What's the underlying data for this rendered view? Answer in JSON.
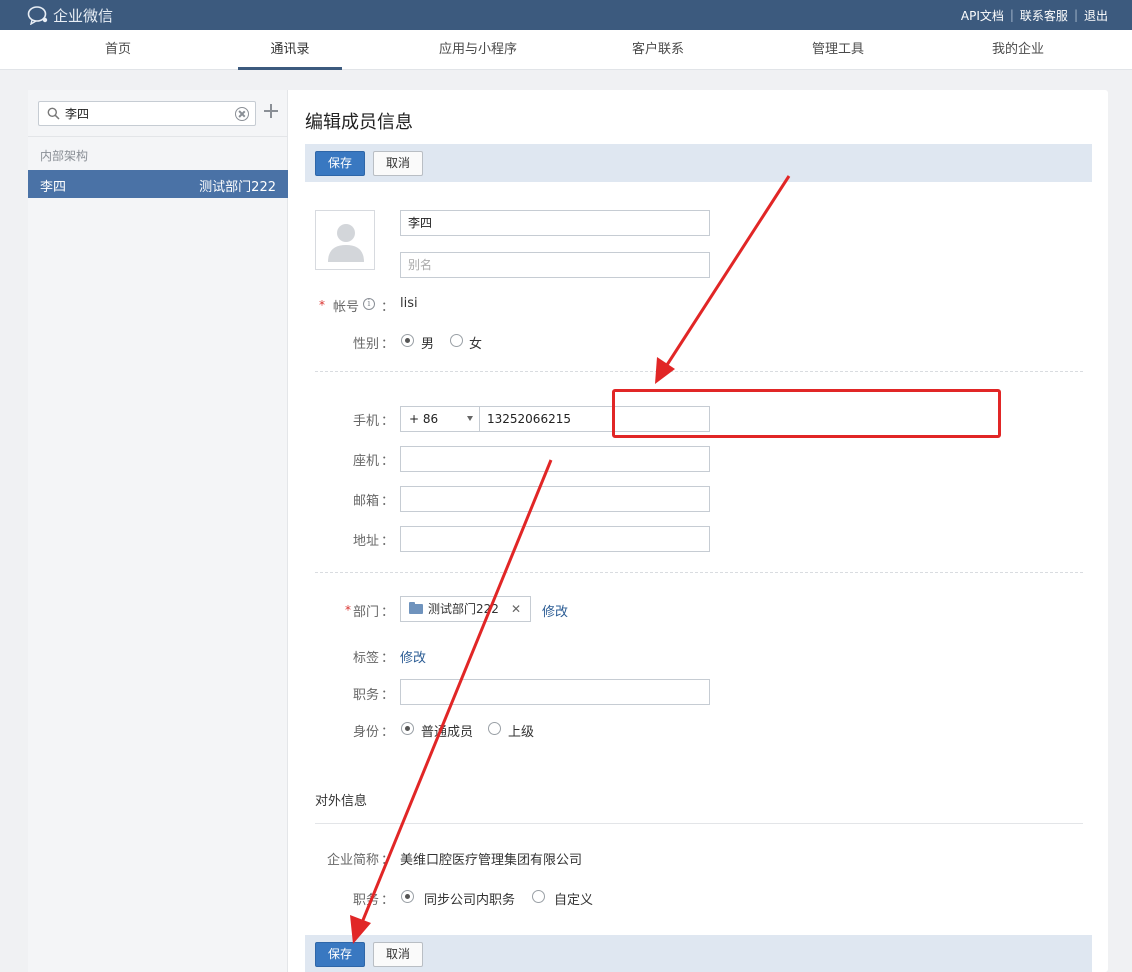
{
  "topbar": {
    "logo_text": "企业微信",
    "links": [
      "API文档",
      "联系客服",
      "退出"
    ]
  },
  "nav": {
    "items": [
      "首页",
      "通讯录",
      "应用与小程序",
      "客户联系",
      "管理工具",
      "我的企业"
    ],
    "active_index": 1
  },
  "sidebar": {
    "search_value": "李四",
    "section_label": "内部架构",
    "selected_member": {
      "name": "李四",
      "department": "测试部门222"
    }
  },
  "form": {
    "title": "编辑成员信息",
    "save_label": "保存",
    "cancel_label": "取消",
    "name_value": "李四",
    "alias_placeholder": "别名",
    "account_label": "帐号",
    "account_value": "lisi",
    "gender_label": "性别",
    "gender_options": [
      "男",
      "女"
    ],
    "gender_selected": "男",
    "mobile_label": "手机",
    "country_code": "+ 86",
    "mobile_value": "13252066215",
    "landline_label": "座机",
    "email_label": "邮箱",
    "address_label": "地址",
    "department_label": "部门",
    "department_value": "测试部门222",
    "modify_label": "修改",
    "tag_label": "标签",
    "position_label": "职务",
    "identity_label": "身份",
    "identity_options": [
      "普通成员",
      "上级"
    ],
    "identity_selected": "普通成员",
    "external_title": "对外信息",
    "company_short_label": "企业简称",
    "company_short_value": "美维口腔医疗管理集团有限公司",
    "external_position_label": "职务",
    "external_position_options": [
      "同步公司内职务",
      "自定义"
    ],
    "external_position_selected": "同步公司内职务",
    "colon": "："
  },
  "colors": {
    "topbar": "#3c5a7e",
    "primary_button": "#3978c1",
    "selected_row": "#4a72a6",
    "annotation": "#e12626"
  }
}
